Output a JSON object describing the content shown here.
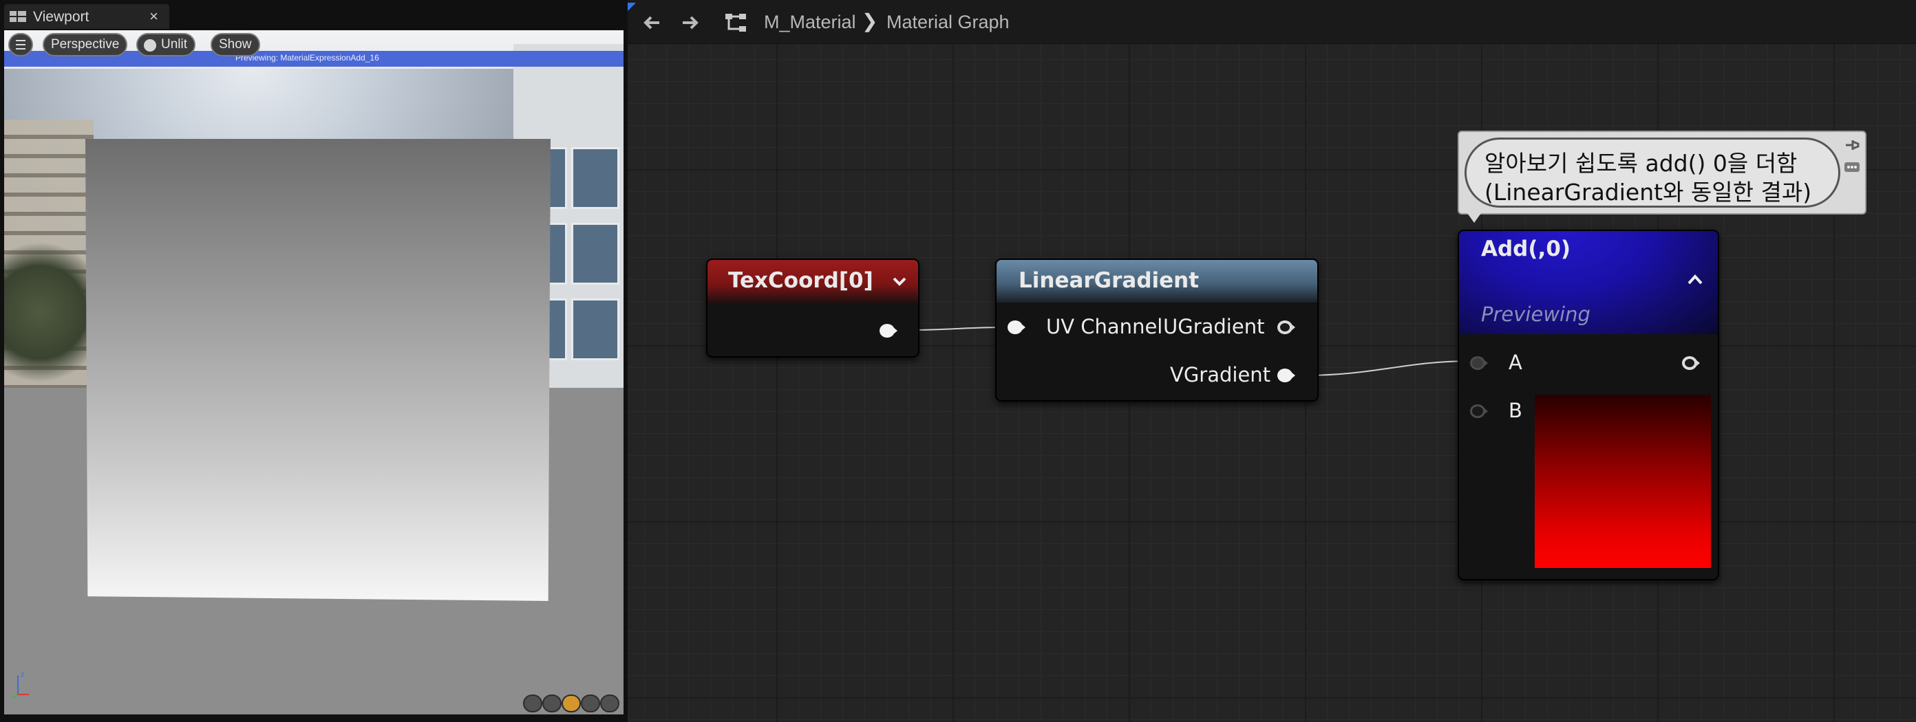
{
  "viewport": {
    "tab_label": "Viewport",
    "close_glyph": "×",
    "toolbar": {
      "menu_icon": "hamburger-menu-icon",
      "perspective_label": "Perspective",
      "unlit_label": "Unlit",
      "show_label": "Show"
    },
    "preview_text": "Previewing: MaterialExpressionAdd_16",
    "view_mode_icons": [
      "wireframe-icon",
      "sphere-icon",
      "lit-icon",
      "cube-icon",
      "unlit-icon"
    ]
  },
  "graph": {
    "back_icon": "arrow-left-icon",
    "forward_icon": "arrow-right-icon",
    "graph_icon": "graph-hierarchy-icon",
    "breadcrumb": [
      "M_Material",
      "Material Graph"
    ],
    "breadcrumb_sep": "❯",
    "comment_lines": [
      "알아보기 쉽도록 add() 0을 더함",
      "(LinearGradient와 동일한 결과)"
    ],
    "nodes": {
      "texcoord": {
        "title": "TexCoord[0]",
        "header_color": "#9a1c1c"
      },
      "linear_gradient": {
        "title": "LinearGradient",
        "inputs": [
          "UV Channel"
        ],
        "outputs": [
          "UGradient",
          "VGradient"
        ],
        "header_color": "#5e7e9a"
      },
      "add": {
        "title": "Add(,0)",
        "status": "Previewing",
        "inputs": [
          "A",
          "B"
        ],
        "header_color": "#1e14b8",
        "preview_color": "#ff0000"
      }
    },
    "wire_color": "#d0d0d0"
  }
}
